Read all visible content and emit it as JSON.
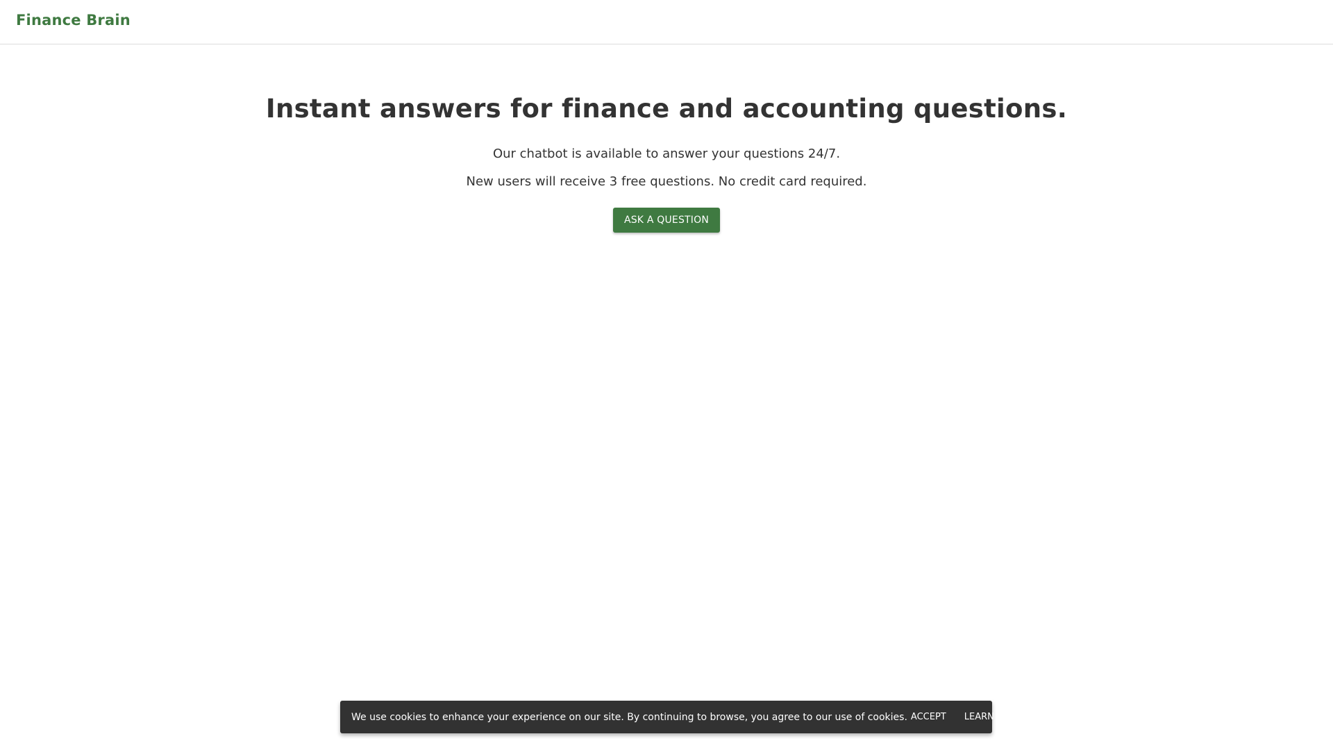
{
  "header": {
    "brand": "Finance Brain"
  },
  "hero": {
    "title": "Instant answers for finance and accounting questions.",
    "line1": "Our chatbot is available to answer your questions 24/7.",
    "line2": "New users will receive 3 free questions. No credit card required.",
    "cta_label": "ASK A QUESTION"
  },
  "cookie_banner": {
    "message": "We use cookies to enhance your experience on our site. By continuing to browse, you agree to our use of cookies.",
    "accept_label": "ACCEPT",
    "learn_more_label": "LEARN MORE"
  },
  "colors": {
    "brand": "#3f7a41",
    "text": "#333333",
    "banner_bg": "#323232"
  }
}
